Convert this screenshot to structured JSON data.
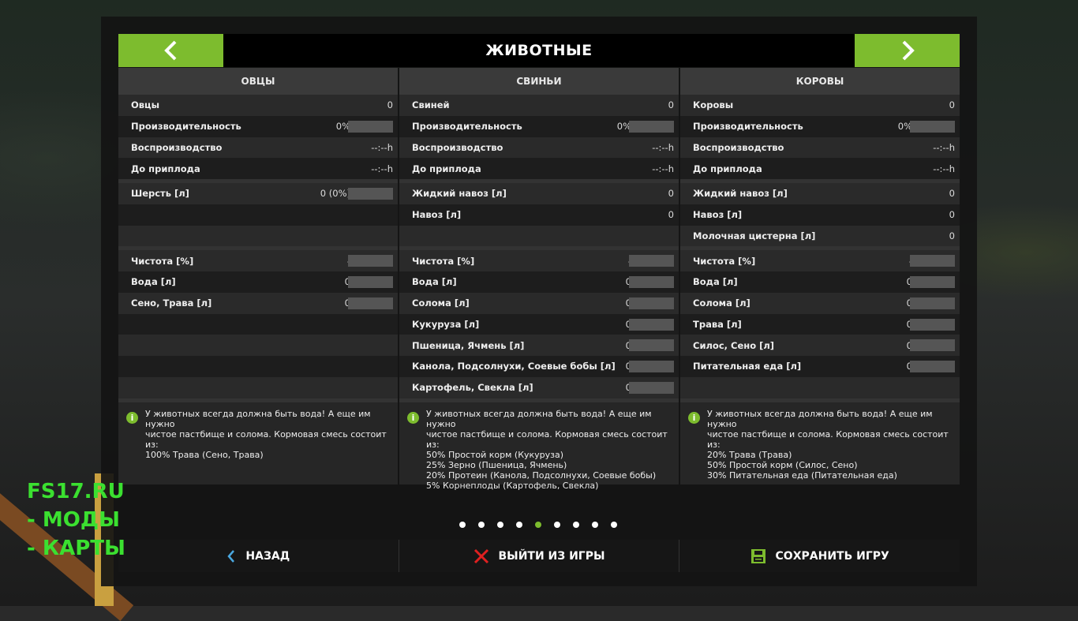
{
  "title": "ЖИВОТНЫЕ",
  "columns": [
    {
      "header": "ОВЦЫ",
      "rows": [
        {
          "label": "Овцы",
          "value": "0",
          "bar": false
        },
        {
          "label": "Производительность",
          "value": "0%",
          "bar": true
        },
        {
          "label": "Воспроизводство",
          "value": "--:--h",
          "bar": false
        },
        {
          "label": "До приплода",
          "value": "--:--h",
          "bar": false
        }
      ],
      "products": [
        {
          "label": "Шерсть [л]",
          "value": "0 (0%)",
          "bar": true
        },
        {
          "label": "",
          "value": "",
          "bar": false
        },
        {
          "label": "",
          "value": "",
          "bar": false
        }
      ],
      "feeds": [
        {
          "label": "Чистота [%]",
          "value": "-",
          "bar": true
        },
        {
          "label": "Вода [л]",
          "value": "0",
          "bar": true
        },
        {
          "label": "Сено, Трава [л]",
          "value": "0",
          "bar": true
        },
        {
          "label": "",
          "value": "",
          "bar": false
        },
        {
          "label": "",
          "value": "",
          "bar": false
        },
        {
          "label": "",
          "value": "",
          "bar": false
        },
        {
          "label": "",
          "value": "",
          "bar": false
        }
      ],
      "info": "У животных всегда должна быть вода! А еще им нужно\nчистое пастбище и солома. Кормовая смесь состоит\nиз:\n100% Трава (Сено, Трава)"
    },
    {
      "header": "СВИНЬИ",
      "rows": [
        {
          "label": "Свиней",
          "value": "0",
          "bar": false
        },
        {
          "label": "Производительность",
          "value": "0%",
          "bar": true
        },
        {
          "label": "Воспроизводство",
          "value": "--:--h",
          "bar": false
        },
        {
          "label": "До приплода",
          "value": "--:--h",
          "bar": false
        }
      ],
      "products": [
        {
          "label": "Жидкий навоз [л]",
          "value": "0",
          "bar": false
        },
        {
          "label": "Навоз [л]",
          "value": "0",
          "bar": false
        },
        {
          "label": "",
          "value": "",
          "bar": false
        }
      ],
      "feeds": [
        {
          "label": "Чистота [%]",
          "value": "-",
          "bar": true
        },
        {
          "label": "Вода [л]",
          "value": "0",
          "bar": true
        },
        {
          "label": "Солома [л]",
          "value": "0",
          "bar": true
        },
        {
          "label": "Кукуруза [л]",
          "value": "0",
          "bar": true
        },
        {
          "label": "Пшеница, Ячмень [л]",
          "value": "0",
          "bar": true
        },
        {
          "label": "Канола, Подсолнухи, Соевые бобы [л]",
          "value": "0",
          "bar": true
        },
        {
          "label": "Картофель, Свекла [л]",
          "value": "0",
          "bar": true
        }
      ],
      "info": "У животных всегда должна быть вода! А еще им нужно\nчистое пастбище и солома. Кормовая смесь состоит\nиз:\n50% Простой корм (Кукуруза)\n25% Зерно (Пшеница, Ячмень)\n20% Протеин (Канола, Подсолнухи, Соевые бобы)\n5% Корнеплоды (Картофель, Свекла)"
    },
    {
      "header": "КОРОВЫ",
      "rows": [
        {
          "label": "Коровы",
          "value": "0",
          "bar": false
        },
        {
          "label": "Производительность",
          "value": "0%",
          "bar": true
        },
        {
          "label": "Воспроизводство",
          "value": "--:--h",
          "bar": false
        },
        {
          "label": "До приплода",
          "value": "--:--h",
          "bar": false
        }
      ],
      "products": [
        {
          "label": "Жидкий навоз [л]",
          "value": "0",
          "bar": false
        },
        {
          "label": "Навоз [л]",
          "value": "0",
          "bar": false
        },
        {
          "label": "Молочная цистерна [л]",
          "value": "0",
          "bar": false
        }
      ],
      "feeds": [
        {
          "label": "Чистота [%]",
          "value": "-",
          "bar": true
        },
        {
          "label": "Вода [л]",
          "value": "0",
          "bar": true
        },
        {
          "label": "Солома [л]",
          "value": "0",
          "bar": true
        },
        {
          "label": "Трава [л]",
          "value": "0",
          "bar": true
        },
        {
          "label": "Силос, Сено [л]",
          "value": "0",
          "bar": true
        },
        {
          "label": "Питательная еда [л]",
          "value": "0",
          "bar": true
        },
        {
          "label": "",
          "value": "",
          "bar": false
        }
      ],
      "info": "У животных всегда должна быть вода! А еще им нужно\nчистое пастбище и солома. Кормовая смесь состоит\nиз:\n20% Трава (Трава)\n50% Простой корм (Силос, Сено)\n30% Питательная еда (Питательная еда)"
    }
  ],
  "pagination": {
    "count": 9,
    "active_index": 4
  },
  "footer": {
    "back_label": "НАЗАД",
    "quit_label": "ВЫЙТИ ИЗ ИГРЫ",
    "save_label": "СОХРАНИТЬ ИГРУ"
  },
  "watermark": {
    "line1": "FS17.RU",
    "line2": " - МОДЫ",
    "line3": " - КАРТЫ"
  },
  "colors": {
    "accent": "#7dbc2e",
    "quit_icon": "#e02020"
  }
}
